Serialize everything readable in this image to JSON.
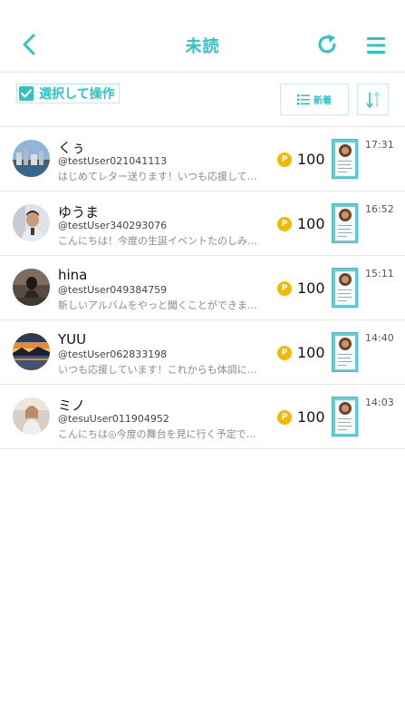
{
  "header": {
    "title": "未読",
    "icons": {
      "back": "chevron-left-icon",
      "refresh": "refresh-icon",
      "menu": "hamburger-menu-icon"
    },
    "accent": "#2ec4c6"
  },
  "toolbar": {
    "select_label": "選択して操作",
    "sort_new_label": "新着",
    "icons": {
      "select": "checkbox-icon",
      "sort_new": "list-icon",
      "sort_order": "sort-arrows-icon"
    }
  },
  "messages": [
    {
      "name": "くぅ",
      "user_id": "@testUser021041113",
      "preview": "はじめてレター送ります！いつも応援していま...",
      "points": "100",
      "time": "17:31"
    },
    {
      "name": "ゆうま",
      "user_id": "@testUser340293076",
      "preview": "こんにちは！今度の生誕イベントたのしみにし...",
      "points": "100",
      "time": "16:52"
    },
    {
      "name": "hina",
      "user_id": "@testUser049384759",
      "preview": "新しいアルバムをやっと聞くことができました...",
      "points": "100",
      "time": "15:11"
    },
    {
      "name": "YUU",
      "user_id": "@testUser062833198",
      "preview": "いつも応援しています！これからも体調には...",
      "points": "100",
      "time": "14:40"
    },
    {
      "name": "ミノ",
      "user_id": "@tesuUser011904952",
      "preview": "こんにちは◎今度の舞台を見に行く予定です...",
      "points": "100",
      "time": "14:03"
    }
  ],
  "coin_label": "P"
}
